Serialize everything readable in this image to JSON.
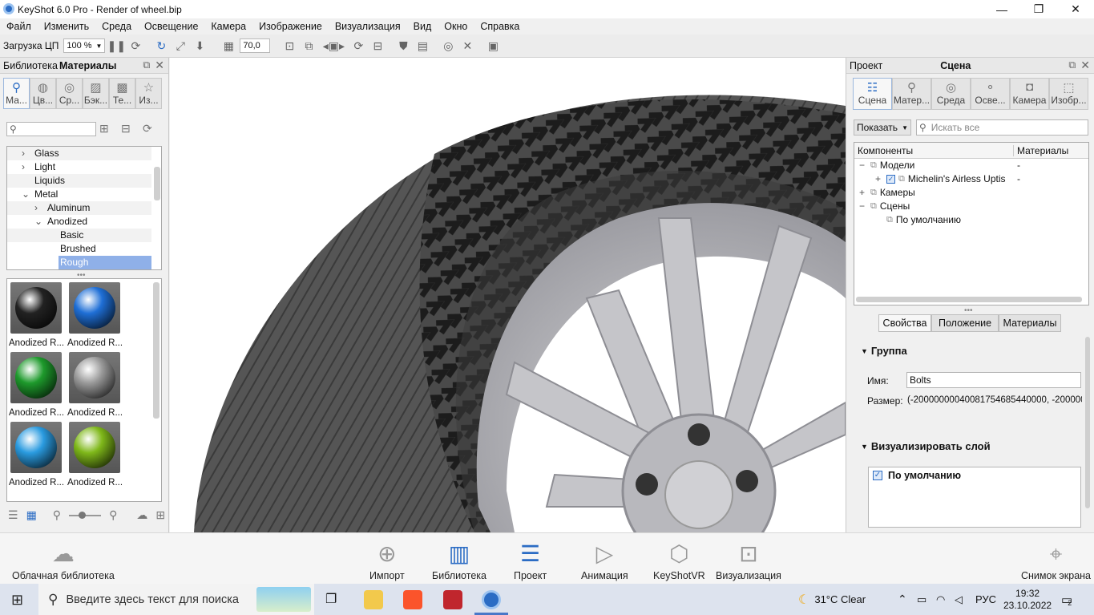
{
  "window": {
    "title": "KeyShot 6.0 Pro  - Render of wheel.bip",
    "minimize": "—",
    "restore": "❐",
    "close": "✕"
  },
  "menu": [
    "Файл",
    "Изменить",
    "Среда",
    "Освещение",
    "Камера",
    "Изображение",
    "Визуализация",
    "Вид",
    "Окно",
    "Справка"
  ],
  "toolbar": {
    "cpu_label": "Загрузка ЦП",
    "zoom": "100 %",
    "fov": "70,0"
  },
  "library": {
    "title_left": "Библиотека",
    "title": "Материалы",
    "tabs": [
      "Ма...",
      "Цв...",
      "Ср...",
      "Бэк...",
      "Те...",
      "Из..."
    ],
    "tree": [
      {
        "label": "Glass",
        "indent": 1,
        "arrow": "›"
      },
      {
        "label": "Light",
        "indent": 1,
        "arrow": "›"
      },
      {
        "label": "Liquids",
        "indent": 1,
        "arrow": ""
      },
      {
        "label": "Metal",
        "indent": 1,
        "arrow": "⌄"
      },
      {
        "label": "Aluminum",
        "indent": 2,
        "arrow": "›"
      },
      {
        "label": "Anodized",
        "indent": 2,
        "arrow": "⌄"
      },
      {
        "label": "Basic",
        "indent": 3,
        "arrow": ""
      },
      {
        "label": "Brushed",
        "indent": 3,
        "arrow": ""
      },
      {
        "label": "Rough",
        "indent": 3,
        "arrow": "",
        "selected": true
      }
    ],
    "thumbs": [
      {
        "label": "Anodized R...",
        "color": "#222222"
      },
      {
        "label": "Anodized R...",
        "color": "#1f6fd6"
      },
      {
        "label": "Anodized R...",
        "color": "#1e9a2c"
      },
      {
        "label": "Anodized R...",
        "color": "#9a9a9a"
      },
      {
        "label": "Anodized R...",
        "color": "#2a9be0"
      },
      {
        "label": "Anodized R...",
        "color": "#7fb81a"
      }
    ]
  },
  "project": {
    "title_left": "Проект",
    "title": "Сцена",
    "tabs": [
      "Сцена",
      "Матер...",
      "Среда",
      "Осве...",
      "Камера",
      "Изобр..."
    ],
    "show_button": "Показать",
    "search_placeholder": "Искать все",
    "col_components": "Компоненты",
    "col_materials": "Материалы",
    "tree": [
      {
        "label": "Модели",
        "mat": "-",
        "exp": "−",
        "indent": 0
      },
      {
        "label": "Michelin's Airless Uptis",
        "mat": "-",
        "exp": "+",
        "indent": 1,
        "checked": true
      },
      {
        "label": "Камеры",
        "mat": "",
        "exp": "+",
        "indent": 0
      },
      {
        "label": "Сцены",
        "mat": "",
        "exp": "−",
        "indent": 0
      },
      {
        "label": "По умолчанию",
        "mat": "",
        "exp": "",
        "indent": 1
      }
    ],
    "subtabs": [
      "Свойства",
      "Положение",
      "Материалы"
    ],
    "group_header": "Группа",
    "name_label": "Имя:",
    "name_value": "Bolts",
    "size_label": "Размер:",
    "size_value": "(-20000000040081754685440000, -2000000",
    "layer_header": "Визуализировать слой",
    "layer_item": "По умолчанию"
  },
  "bottombar": [
    {
      "label": "Облачная библиотека",
      "icon": "cloud-library-icon"
    },
    {
      "label": "Импорт",
      "icon": "import-icon"
    },
    {
      "label": "Библиотека",
      "icon": "library-book-icon",
      "active": true
    },
    {
      "label": "Проект",
      "icon": "project-icon",
      "active": true
    },
    {
      "label": "Анимация",
      "icon": "animation-play-icon"
    },
    {
      "label": "KeyShotVR",
      "icon": "keyshotvr-cube-icon"
    },
    {
      "label": "Визуализация",
      "icon": "render-icon"
    },
    {
      "label": "Снимок экрана",
      "icon": "screenshot-icon"
    }
  ],
  "taskbar": {
    "search_text": "Введите здесь текст для поиска",
    "weather": "31°C  Clear",
    "lang": "РУС",
    "time": "19:32",
    "date": "23.10.2022",
    "notif": "2"
  }
}
